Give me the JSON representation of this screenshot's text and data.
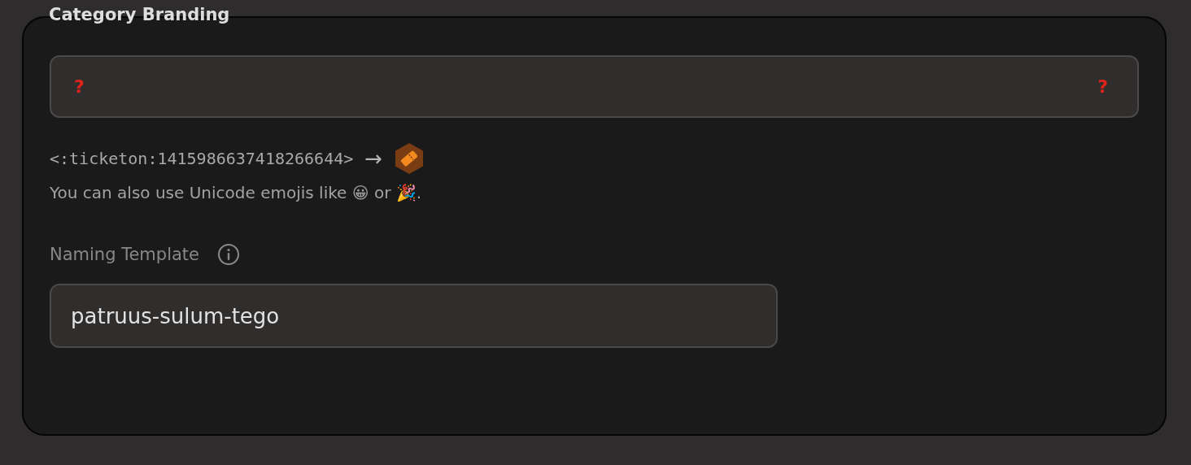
{
  "section": {
    "title": "Category Branding"
  },
  "emoji_field": {
    "value_start": "?",
    "value_end": "?"
  },
  "emoji_preview": {
    "code": "<:ticketon:1415986637418266644>",
    "arrow": "→"
  },
  "hint": "You can also use Unicode emojis like 😀 or 🎉.",
  "naming_template": {
    "label": "Naming Template",
    "value": "patruus-sulum-tego"
  }
}
